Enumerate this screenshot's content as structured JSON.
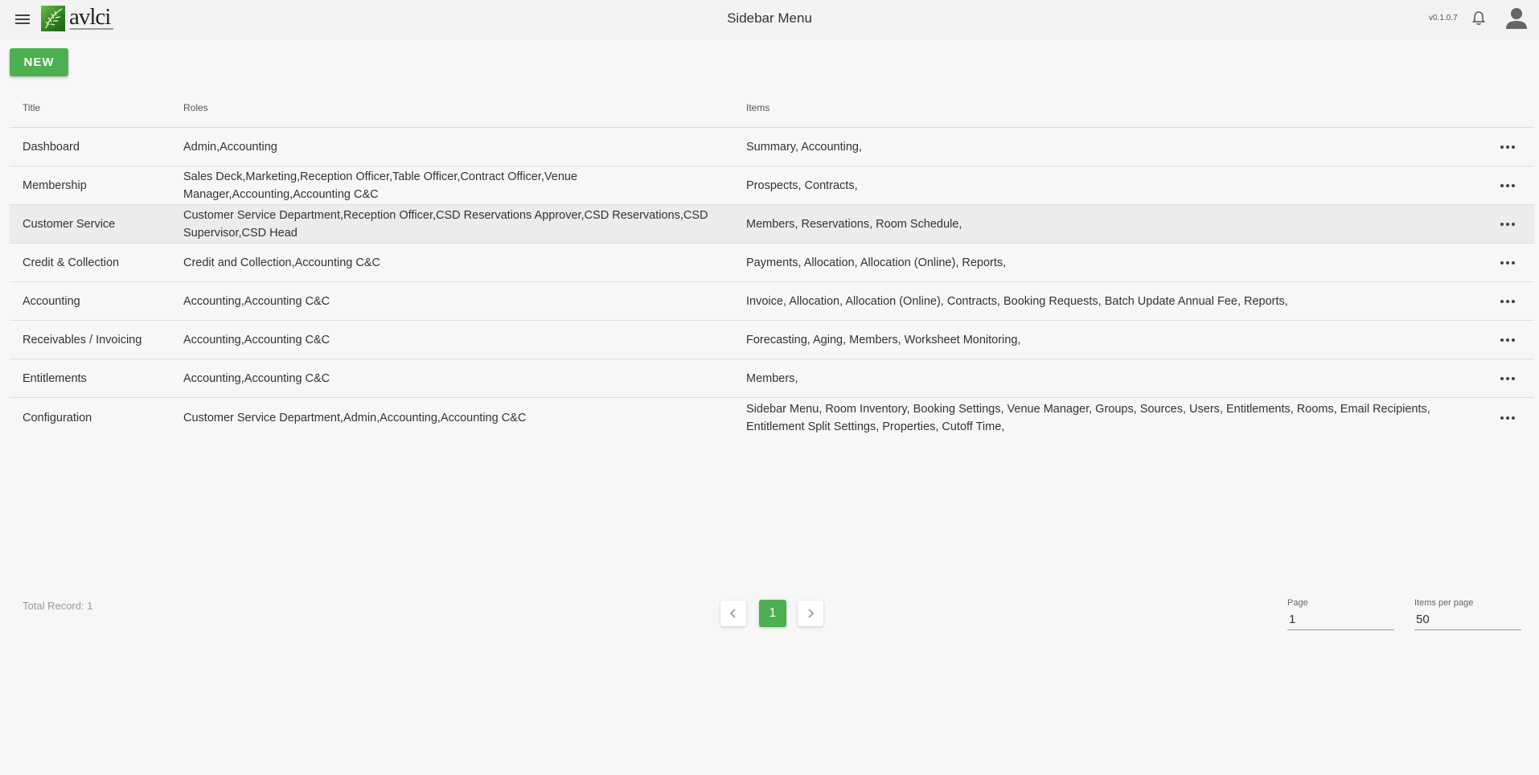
{
  "header": {
    "logo_text": "avlci",
    "title": "Sidebar Menu",
    "version": "v0.1.0.7"
  },
  "toolbar": {
    "new_label": "NEW"
  },
  "table": {
    "columns": [
      "Title",
      "Roles",
      "Items"
    ],
    "rows": [
      {
        "title": "Dashboard",
        "roles": "Admin,Accounting",
        "items": "Summary, Accounting,"
      },
      {
        "title": "Membership",
        "roles": "Sales Deck,Marketing,Reception Officer,Table Officer,Contract Officer,Venue Manager,Accounting,Accounting C&C",
        "items": "Prospects, Contracts,"
      },
      {
        "title": "Customer Service",
        "roles": "Customer Service Department,Reception Officer,CSD Reservations Approver,CSD Reservations,CSD Supervisor,CSD Head",
        "items": "Members, Reservations, Room Schedule,"
      },
      {
        "title": "Credit & Collection",
        "roles": "Credit and Collection,Accounting C&C",
        "items": "Payments, Allocation, Allocation (Online), Reports,"
      },
      {
        "title": "Accounting",
        "roles": "Accounting,Accounting C&C",
        "items": "Invoice, Allocation, Allocation (Online), Contracts, Booking Requests, Batch Update Annual Fee, Reports,"
      },
      {
        "title": "Receivables / Invoicing",
        "roles": "Accounting,Accounting C&C",
        "items": "Forecasting, Aging, Members, Worksheet Monitoring,"
      },
      {
        "title": "Entitlements",
        "roles": "Accounting,Accounting C&C",
        "items": "Members,"
      },
      {
        "title": "Configuration",
        "roles": "Customer Service Department,Admin,Accounting,Accounting C&C",
        "items": "Sidebar Menu, Room Inventory, Booking Settings, Venue Manager, Groups, Sources, Users, Entitlements, Rooms, Email Recipients, Entitlement Split Settings, Properties, Cutoff Time,"
      }
    ]
  },
  "footer": {
    "total_record": "Total Record: 1",
    "current_page": "1",
    "page_label": "Page",
    "page_value": "1",
    "items_per_page_label": "Items per page",
    "items_per_page_value": "50"
  },
  "colors": {
    "accent": "#4caf50",
    "highlight_row": "#ececec"
  },
  "icons": [
    "menu-icon",
    "logo-leaf-icon",
    "bell-icon",
    "account-icon",
    "more-horizontal-icon",
    "chevron-left-icon",
    "chevron-right-icon"
  ]
}
